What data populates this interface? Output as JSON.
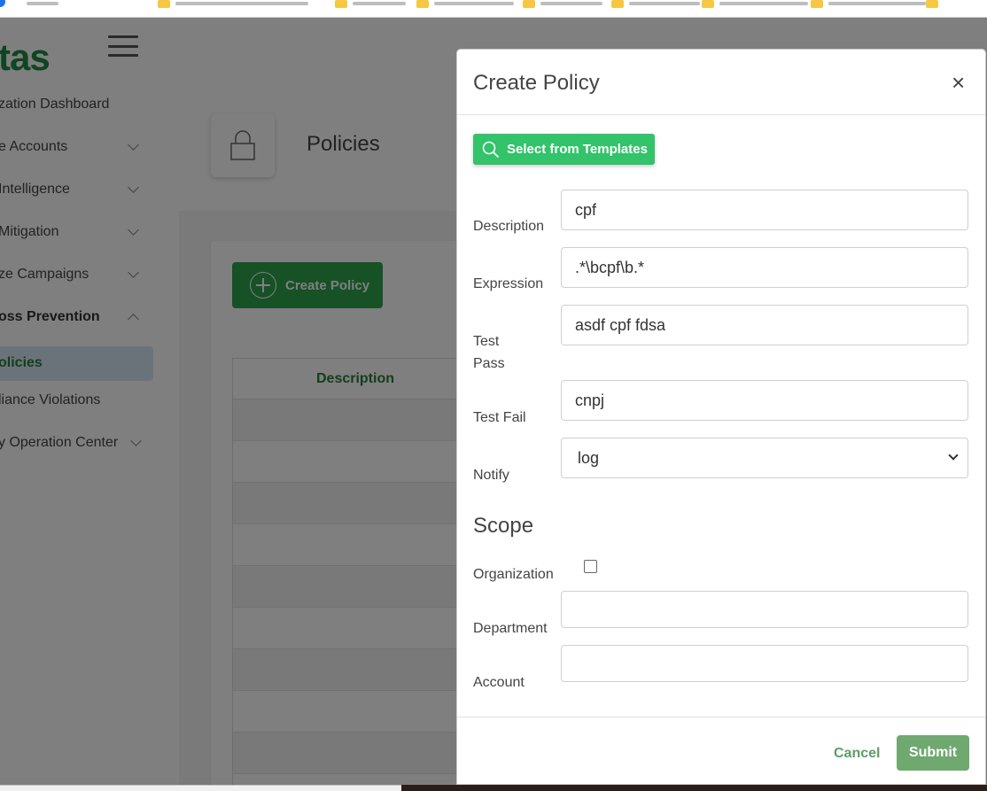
{
  "app": {
    "logo_text": "tas",
    "colors": {
      "brand": "#1f8b44",
      "accent": "#2ea24c",
      "template_button": "#32c36b",
      "submit": "#6fa96f"
    }
  },
  "sidebar": {
    "items": [
      {
        "label": "zation Dashboard",
        "has_chevron": false
      },
      {
        "label": "e Accounts",
        "has_chevron": true
      },
      {
        "label": "Intelligence",
        "has_chevron": true
      },
      {
        "label": "Mitigation",
        "has_chevron": true
      },
      {
        "label": "ze Campaigns",
        "has_chevron": true
      },
      {
        "label": "oss Prevention",
        "has_chevron": true,
        "expanded": true
      },
      {
        "label": "olicies",
        "active": true
      },
      {
        "label": "liance Violations"
      },
      {
        "label": "y Operation Center",
        "has_chevron": true
      }
    ]
  },
  "page": {
    "title": "Policies",
    "lock_icon": "lock-icon",
    "create_button": "Create Policy",
    "table": {
      "header": "Description"
    }
  },
  "modal": {
    "title": "Create Policy",
    "close_label": "×",
    "template_button": "Select from Templates",
    "fields": {
      "description": {
        "label": "Description",
        "value": "cpf"
      },
      "expression": {
        "label": "Expression",
        "value": ".*\\bcpf\\b.*"
      },
      "test_pass": {
        "label": "Test Pass",
        "value": "asdf cpf fdsa"
      },
      "test_fail": {
        "label": "Test Fail",
        "value": "cnpj"
      },
      "notify": {
        "label": "Notify",
        "value": "log"
      }
    },
    "scope": {
      "heading": "Scope",
      "organization": {
        "label": "Organization",
        "checked": false
      },
      "department": {
        "label": "Department",
        "value": ""
      },
      "account": {
        "label": "Account",
        "value": ""
      }
    },
    "footer": {
      "cancel": "Cancel",
      "submit": "Submit"
    }
  }
}
